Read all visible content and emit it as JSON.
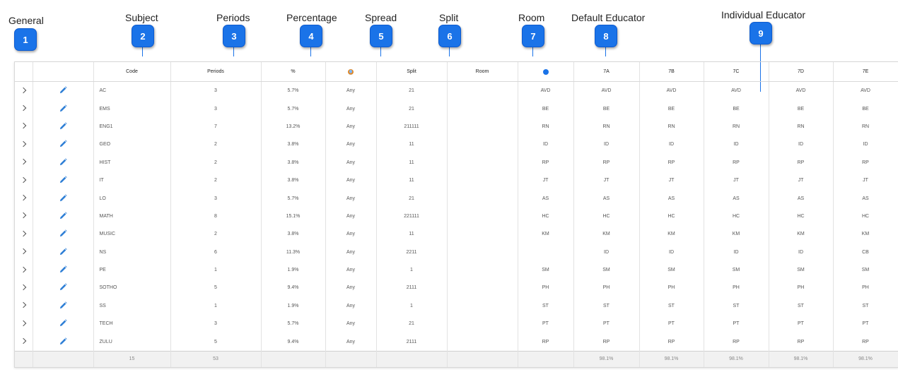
{
  "callouts": [
    {
      "label": "General",
      "num": "1"
    },
    {
      "label": "Subject",
      "num": "2"
    },
    {
      "label": "Periods",
      "num": "3"
    },
    {
      "label": "Percentage",
      "num": "4"
    },
    {
      "label": "Spread",
      "num": "5"
    },
    {
      "label": "Split",
      "num": "6"
    },
    {
      "label": "Room",
      "num": "7"
    },
    {
      "label": "Default Educator",
      "num": "8"
    },
    {
      "label": "Individual Educator",
      "num": "9"
    }
  ],
  "table": {
    "headers": {
      "code": "Code",
      "periods": "Periods",
      "percent": "%",
      "spread_icon": "spread-filter-icon",
      "split": "Split",
      "room": "Room",
      "default_icon": "info-icon",
      "classes": [
        "7A",
        "7B",
        "7C",
        "7D",
        "7E"
      ]
    },
    "rows": [
      {
        "code": "AC",
        "periods": "3",
        "percent": "5.7%",
        "spread": "Any",
        "split": "21",
        "room": "",
        "def": "AVD",
        "c": [
          "AVD",
          "AVD",
          "AVD",
          "AVD",
          "AVD"
        ]
      },
      {
        "code": "EMS",
        "periods": "3",
        "percent": "5.7%",
        "spread": "Any",
        "split": "21",
        "room": "",
        "def": "BE",
        "c": [
          "BE",
          "BE",
          "BE",
          "BE",
          "BE"
        ]
      },
      {
        "code": "ENG1",
        "periods": "7",
        "percent": "13.2%",
        "spread": "Any",
        "split": "211111",
        "room": "",
        "def": "RN",
        "c": [
          "RN",
          "RN",
          "RN",
          "RN",
          "RN"
        ]
      },
      {
        "code": "GEO",
        "periods": "2",
        "percent": "3.8%",
        "spread": "Any",
        "split": "11",
        "room": "",
        "def": "ID",
        "c": [
          "ID",
          "ID",
          "ID",
          "ID",
          "ID"
        ]
      },
      {
        "code": "HIST",
        "periods": "2",
        "percent": "3.8%",
        "spread": "Any",
        "split": "11",
        "room": "",
        "def": "RP",
        "c": [
          "RP",
          "RP",
          "RP",
          "RP",
          "RP"
        ]
      },
      {
        "code": "IT",
        "periods": "2",
        "percent": "3.8%",
        "spread": "Any",
        "split": "11",
        "room": "",
        "def": "JT",
        "c": [
          "JT",
          "JT",
          "JT",
          "JT",
          "JT"
        ]
      },
      {
        "code": "LO",
        "periods": "3",
        "percent": "5.7%",
        "spread": "Any",
        "split": "21",
        "room": "",
        "def": "AS",
        "c": [
          "AS",
          "AS",
          "AS",
          "AS",
          "AS"
        ]
      },
      {
        "code": "MATH",
        "periods": "8",
        "percent": "15.1%",
        "spread": "Any",
        "split": "221111",
        "room": "",
        "def": "HC",
        "c": [
          "HC",
          "HC",
          "HC",
          "HC",
          "HC"
        ]
      },
      {
        "code": "MUSIC",
        "periods": "2",
        "percent": "3.8%",
        "spread": "Any",
        "split": "11",
        "room": "",
        "def": "KM",
        "c": [
          "KM",
          "KM",
          "KM",
          "KM",
          "KM"
        ]
      },
      {
        "code": "NS",
        "periods": "6",
        "percent": "11.3%",
        "spread": "Any",
        "split": "2211",
        "room": "",
        "def": "",
        "c": [
          "ID",
          "ID",
          "ID",
          "ID",
          "CB"
        ]
      },
      {
        "code": "PE",
        "periods": "1",
        "percent": "1.9%",
        "spread": "Any",
        "split": "1",
        "room": "",
        "def": "SM",
        "c": [
          "SM",
          "SM",
          "SM",
          "SM",
          "SM"
        ]
      },
      {
        "code": "SOTHO",
        "periods": "5",
        "percent": "9.4%",
        "spread": "Any",
        "split": "2111",
        "room": "",
        "def": "PH",
        "c": [
          "PH",
          "PH",
          "PH",
          "PH",
          "PH"
        ]
      },
      {
        "code": "SS",
        "periods": "1",
        "percent": "1.9%",
        "spread": "Any",
        "split": "1",
        "room": "",
        "def": "ST",
        "c": [
          "ST",
          "ST",
          "ST",
          "ST",
          "ST"
        ]
      },
      {
        "code": "TECH",
        "periods": "3",
        "percent": "5.7%",
        "spread": "Any",
        "split": "21",
        "room": "",
        "def": "PT",
        "c": [
          "PT",
          "PT",
          "PT",
          "PT",
          "PT"
        ]
      },
      {
        "code": "ZULU",
        "periods": "5",
        "percent": "9.4%",
        "spread": "Any",
        "split": "2111",
        "room": "",
        "def": "RP",
        "c": [
          "RP",
          "RP",
          "RP",
          "RP",
          "RP"
        ]
      }
    ],
    "footer": {
      "code_count": "15",
      "periods_total": "53",
      "class_pct": [
        "98.1%",
        "98.1%",
        "98.1%",
        "98.1%",
        "98.1%"
      ]
    }
  },
  "colors": {
    "badge": "#1a73e8",
    "pencil": "#2f7fd6"
  }
}
